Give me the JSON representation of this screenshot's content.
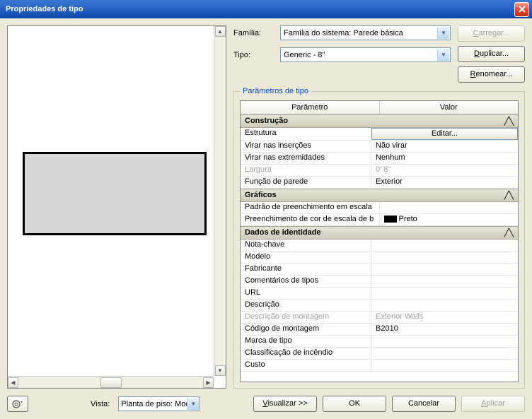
{
  "window": {
    "title": "Propriedades de tipo"
  },
  "form": {
    "familia_label": "Família:",
    "familia_value": "Família do sistema: Parede básica",
    "tipo_label": "Tipo:",
    "tipo_value": "Generic - 8\""
  },
  "buttons": {
    "carregar": "Carregar...",
    "duplicar": "Duplicar...",
    "renomear": "Renomear...",
    "visualizar": "Visualizar >>",
    "ok": "OK",
    "cancelar": "Cancelar",
    "aplicar": "Aplicar",
    "editar": "Editar..."
  },
  "params": {
    "group_title": "Parâmetros de tipo",
    "header_param": "Parâmetro",
    "header_valor": "Valor",
    "sections": {
      "construcao": "Construção",
      "graficos": "Gráficos",
      "dados": "Dados de identidade"
    },
    "rows": {
      "estrutura": "Estrutura",
      "virar_ins": "Virar nas inserções",
      "virar_ins_v": "Não virar",
      "virar_ext": "Virar nas extremidades",
      "virar_ext_v": "Nenhum",
      "largura": "Largura",
      "largura_v": "0'  8\"",
      "funcao": "Função de parede",
      "funcao_v": "Exterior",
      "padrao": "Padrão de preenchimento em escala",
      "preench": "Preenchimento de cor de escala de b",
      "preench_v": "Preto",
      "nota": "Nota-chave",
      "modelo": "Modelo",
      "fabricante": "Fabricante",
      "coment": "Comentários de tipos",
      "url": "URL",
      "descr": "Descrição",
      "descr_mont": "Descrição de montagem",
      "descr_mont_v": "Exterior Walls",
      "cod_mont": "Código de montagem",
      "cod_mont_v": "B2010",
      "marca": "Marca de tipo",
      "classif": "Classificação de incêndio",
      "custo": "Custo"
    }
  },
  "footer": {
    "vista_label": "Vista:",
    "vista_value": "Planta de piso: Modifi"
  }
}
